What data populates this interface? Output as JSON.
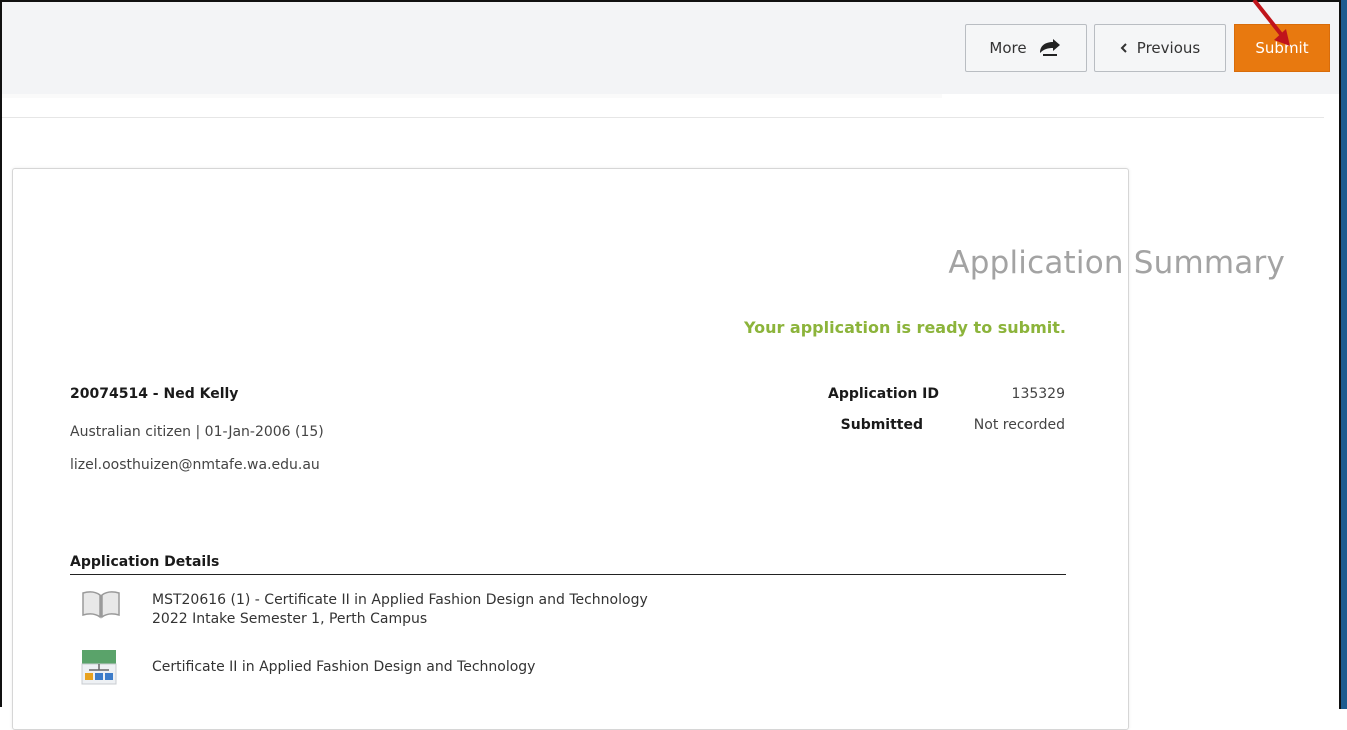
{
  "toolbar": {
    "more_label": "More",
    "previous_label": "Previous",
    "submit_label": "Submit",
    "submit_color": "#e8790f"
  },
  "summary": {
    "title": "Application Summary",
    "status_message": "Your application is ready to submit.",
    "status_color": "#8cb43b"
  },
  "applicant": {
    "name_line": "20074514 - Ned Kelly",
    "info_line": "Australian citizen | 01-Jan-2006 (15)",
    "email": "lizel.oosthuizen@nmtafe.wa.edu.au"
  },
  "application": {
    "id_label": "Application ID",
    "id_value": "135329",
    "submitted_label": "Submitted",
    "submitted_value": "Not recorded"
  },
  "details": {
    "section_title": "Application Details",
    "items": [
      {
        "icon": "book-icon",
        "line1": "MST20616 (1) - Certificate II in Applied Fashion Design and Technology",
        "line2": "2022 Intake Semester 1, Perth Campus"
      },
      {
        "icon": "qualification-icon",
        "line1": "Certificate II in Applied Fashion Design and Technology"
      }
    ]
  }
}
